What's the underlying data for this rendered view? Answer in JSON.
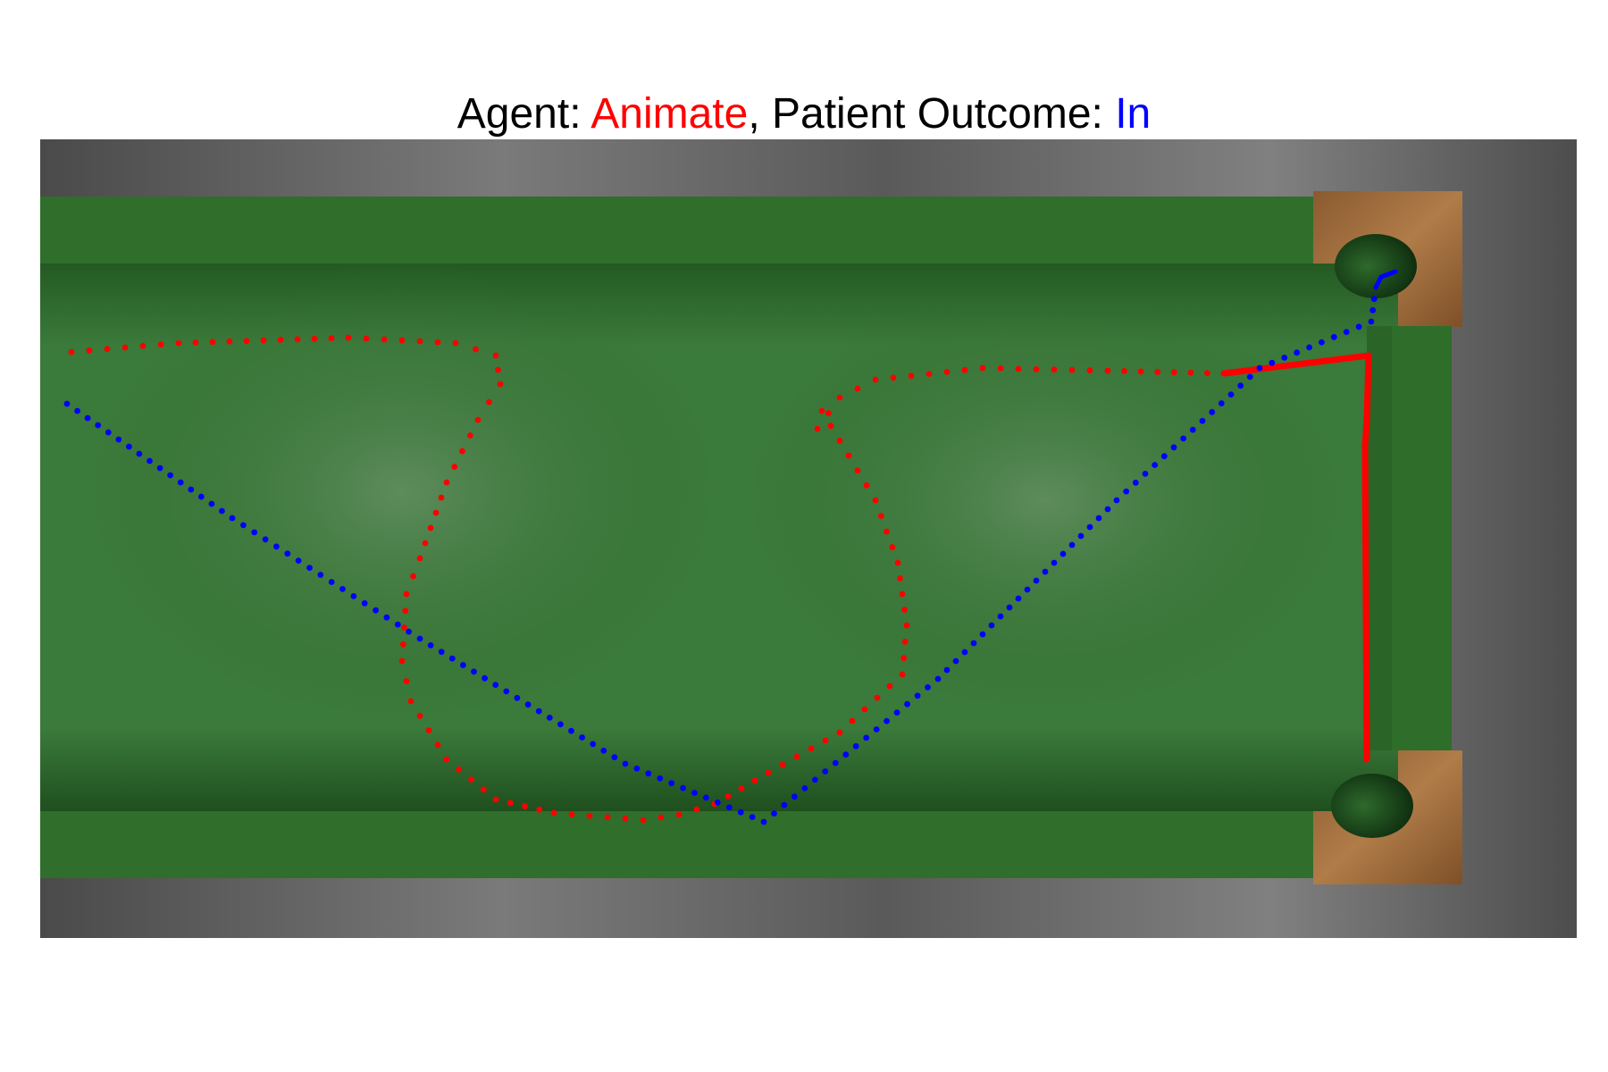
{
  "title": {
    "agent_label": "Agent: ",
    "agent_value": "Animate",
    "separator": ", ",
    "outcome_label": "Patient Outcome: ",
    "outcome_value": "In",
    "agent_color": "#ff0000",
    "outcome_color": "#0000ff",
    "label_color": "#000000"
  },
  "scene": {
    "floor_color": "#6f6f6f",
    "felt_color": "#3f8040",
    "rail_color": "#2e6e2a",
    "wood_color": "#9a6a3c",
    "pocket_color": "#1f4a1e"
  },
  "colors": {
    "agent": "#ff0000",
    "patient": "#0000ff"
  }
}
